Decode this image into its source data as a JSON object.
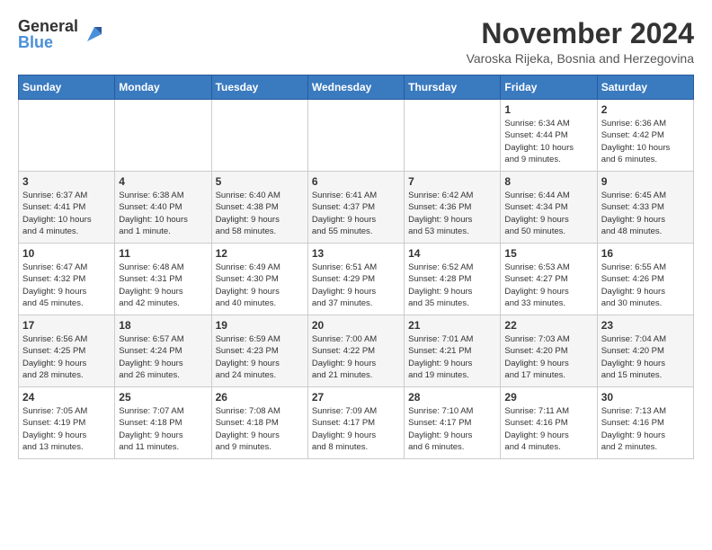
{
  "logo": {
    "text_general": "General",
    "text_blue": "Blue"
  },
  "header": {
    "month_title": "November 2024",
    "location": "Varoska Rijeka, Bosnia and Herzegovina"
  },
  "weekdays": [
    "Sunday",
    "Monday",
    "Tuesday",
    "Wednesday",
    "Thursday",
    "Friday",
    "Saturday"
  ],
  "weeks": [
    [
      {
        "day": "",
        "info": ""
      },
      {
        "day": "",
        "info": ""
      },
      {
        "day": "",
        "info": ""
      },
      {
        "day": "",
        "info": ""
      },
      {
        "day": "",
        "info": ""
      },
      {
        "day": "1",
        "info": "Sunrise: 6:34 AM\nSunset: 4:44 PM\nDaylight: 10 hours\nand 9 minutes."
      },
      {
        "day": "2",
        "info": "Sunrise: 6:36 AM\nSunset: 4:42 PM\nDaylight: 10 hours\nand 6 minutes."
      }
    ],
    [
      {
        "day": "3",
        "info": "Sunrise: 6:37 AM\nSunset: 4:41 PM\nDaylight: 10 hours\nand 4 minutes."
      },
      {
        "day": "4",
        "info": "Sunrise: 6:38 AM\nSunset: 4:40 PM\nDaylight: 10 hours\nand 1 minute."
      },
      {
        "day": "5",
        "info": "Sunrise: 6:40 AM\nSunset: 4:38 PM\nDaylight: 9 hours\nand 58 minutes."
      },
      {
        "day": "6",
        "info": "Sunrise: 6:41 AM\nSunset: 4:37 PM\nDaylight: 9 hours\nand 55 minutes."
      },
      {
        "day": "7",
        "info": "Sunrise: 6:42 AM\nSunset: 4:36 PM\nDaylight: 9 hours\nand 53 minutes."
      },
      {
        "day": "8",
        "info": "Sunrise: 6:44 AM\nSunset: 4:34 PM\nDaylight: 9 hours\nand 50 minutes."
      },
      {
        "day": "9",
        "info": "Sunrise: 6:45 AM\nSunset: 4:33 PM\nDaylight: 9 hours\nand 48 minutes."
      }
    ],
    [
      {
        "day": "10",
        "info": "Sunrise: 6:47 AM\nSunset: 4:32 PM\nDaylight: 9 hours\nand 45 minutes."
      },
      {
        "day": "11",
        "info": "Sunrise: 6:48 AM\nSunset: 4:31 PM\nDaylight: 9 hours\nand 42 minutes."
      },
      {
        "day": "12",
        "info": "Sunrise: 6:49 AM\nSunset: 4:30 PM\nDaylight: 9 hours\nand 40 minutes."
      },
      {
        "day": "13",
        "info": "Sunrise: 6:51 AM\nSunset: 4:29 PM\nDaylight: 9 hours\nand 37 minutes."
      },
      {
        "day": "14",
        "info": "Sunrise: 6:52 AM\nSunset: 4:28 PM\nDaylight: 9 hours\nand 35 minutes."
      },
      {
        "day": "15",
        "info": "Sunrise: 6:53 AM\nSunset: 4:27 PM\nDaylight: 9 hours\nand 33 minutes."
      },
      {
        "day": "16",
        "info": "Sunrise: 6:55 AM\nSunset: 4:26 PM\nDaylight: 9 hours\nand 30 minutes."
      }
    ],
    [
      {
        "day": "17",
        "info": "Sunrise: 6:56 AM\nSunset: 4:25 PM\nDaylight: 9 hours\nand 28 minutes."
      },
      {
        "day": "18",
        "info": "Sunrise: 6:57 AM\nSunset: 4:24 PM\nDaylight: 9 hours\nand 26 minutes."
      },
      {
        "day": "19",
        "info": "Sunrise: 6:59 AM\nSunset: 4:23 PM\nDaylight: 9 hours\nand 24 minutes."
      },
      {
        "day": "20",
        "info": "Sunrise: 7:00 AM\nSunset: 4:22 PM\nDaylight: 9 hours\nand 21 minutes."
      },
      {
        "day": "21",
        "info": "Sunrise: 7:01 AM\nSunset: 4:21 PM\nDaylight: 9 hours\nand 19 minutes."
      },
      {
        "day": "22",
        "info": "Sunrise: 7:03 AM\nSunset: 4:20 PM\nDaylight: 9 hours\nand 17 minutes."
      },
      {
        "day": "23",
        "info": "Sunrise: 7:04 AM\nSunset: 4:20 PM\nDaylight: 9 hours\nand 15 minutes."
      }
    ],
    [
      {
        "day": "24",
        "info": "Sunrise: 7:05 AM\nSunset: 4:19 PM\nDaylight: 9 hours\nand 13 minutes."
      },
      {
        "day": "25",
        "info": "Sunrise: 7:07 AM\nSunset: 4:18 PM\nDaylight: 9 hours\nand 11 minutes."
      },
      {
        "day": "26",
        "info": "Sunrise: 7:08 AM\nSunset: 4:18 PM\nDaylight: 9 hours\nand 9 minutes."
      },
      {
        "day": "27",
        "info": "Sunrise: 7:09 AM\nSunset: 4:17 PM\nDaylight: 9 hours\nand 8 minutes."
      },
      {
        "day": "28",
        "info": "Sunrise: 7:10 AM\nSunset: 4:17 PM\nDaylight: 9 hours\nand 6 minutes."
      },
      {
        "day": "29",
        "info": "Sunrise: 7:11 AM\nSunset: 4:16 PM\nDaylight: 9 hours\nand 4 minutes."
      },
      {
        "day": "30",
        "info": "Sunrise: 7:13 AM\nSunset: 4:16 PM\nDaylight: 9 hours\nand 2 minutes."
      }
    ]
  ]
}
